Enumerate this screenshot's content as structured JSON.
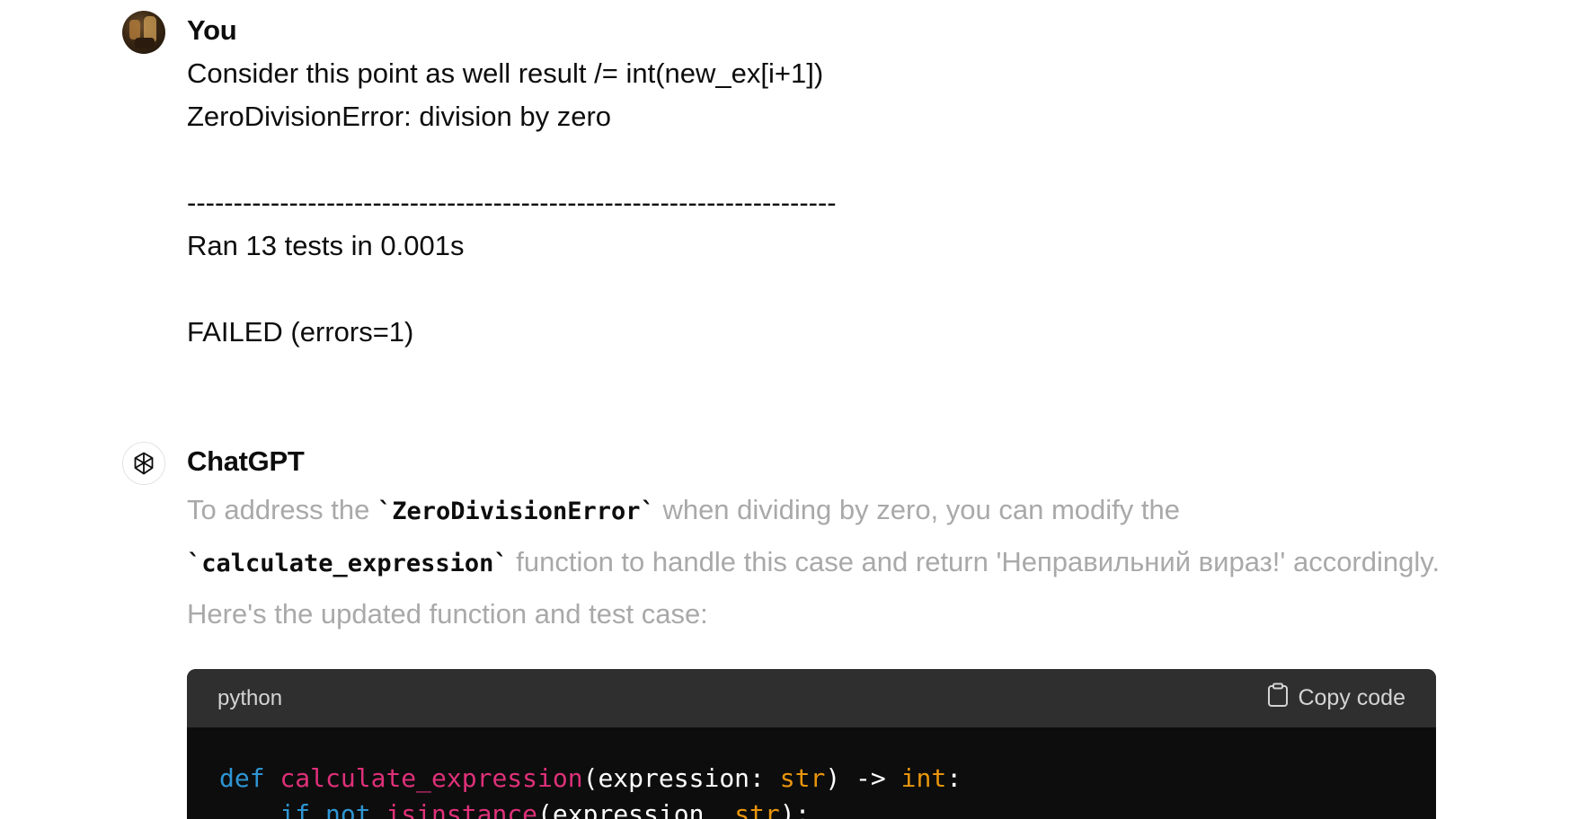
{
  "user_turn": {
    "author": "You",
    "message_lines": [
      "Consider this point as well result /= int(new_ex[i+1])",
      "ZeroDivisionError: division by zero",
      "",
      "----------------------------------------------------------------------",
      "Ran 13 tests in 0.001s",
      "",
      "FAILED (errors=1)"
    ]
  },
  "assistant_turn": {
    "author": "ChatGPT",
    "text": {
      "part1": "To address the ",
      "code1": "`ZeroDivisionError`",
      "part2": " when dividing by zero, you can modify the ",
      "code2": "`calculate_expression`",
      "part3": " function to handle this case and return 'Неправильний вираз!' accordingly. Here's the updated function and test case:"
    },
    "code_block": {
      "language": "python",
      "copy_label": "Copy code",
      "line1": {
        "kw_def": "def",
        "fn_name": "calculate_expression",
        "open_paren": "(",
        "param": "expression: ",
        "param_type": "str",
        "arrow": ") -> ",
        "return_type": "int",
        "colon": ":"
      },
      "line2": {
        "indent": "    ",
        "kw_if": "if",
        "kw_not": "not",
        "fn_isinstance": "isinstance",
        "args": "(expression, ",
        "arg_type": "str",
        "close": "):"
      }
    }
  },
  "colors": {
    "keyword": "#2e95d3",
    "function": "#df3079",
    "type": "#e9950c",
    "faded_text": "#a9a9a9"
  },
  "icons": {
    "copy": "clipboard-icon",
    "bot_avatar": "openai-logo-icon"
  }
}
